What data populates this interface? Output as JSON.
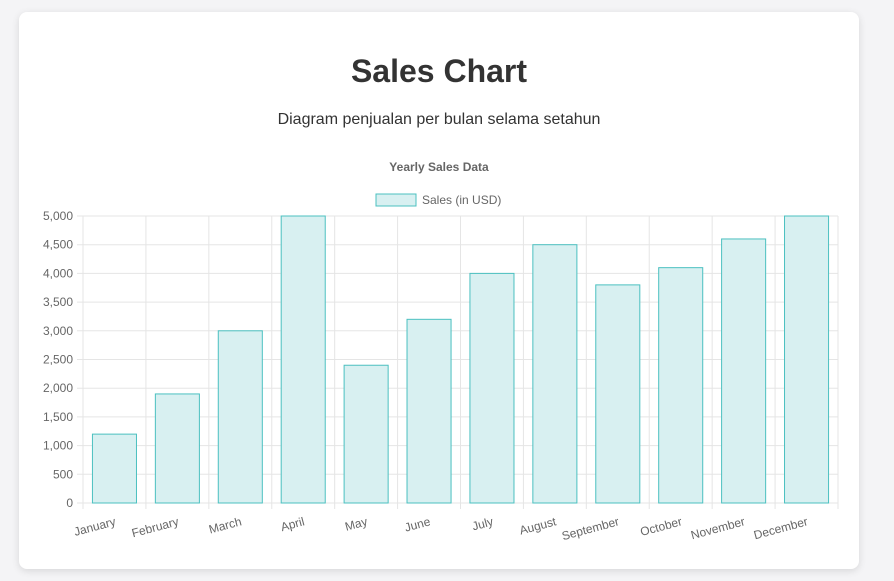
{
  "page": {
    "title": "Sales Chart",
    "subtitle": "Diagram penjualan per bulan selama setahun"
  },
  "chart_data": {
    "type": "bar",
    "title": "Yearly Sales Data",
    "categories": [
      "January",
      "February",
      "March",
      "April",
      "May",
      "June",
      "July",
      "August",
      "September",
      "October",
      "November",
      "December"
    ],
    "series": [
      {
        "name": "Sales (in USD)",
        "values": [
          1200,
          1900,
          3000,
          5000,
          2400,
          3200,
          4000,
          4500,
          3800,
          4100,
          4600,
          5000
        ]
      }
    ],
    "ylim": [
      0,
      5000
    ],
    "yticks": [
      "0",
      "500",
      "1,000",
      "1,500",
      "2,000",
      "2,500",
      "3,000",
      "3,500",
      "4,000",
      "4,500",
      "5,000"
    ],
    "grid": true,
    "legend": "top-center",
    "colors": {
      "bar_fill": "#d8f0f1",
      "bar_border": "#4bc0c0",
      "grid": "#e5e5e5",
      "text": "#666666"
    }
  }
}
